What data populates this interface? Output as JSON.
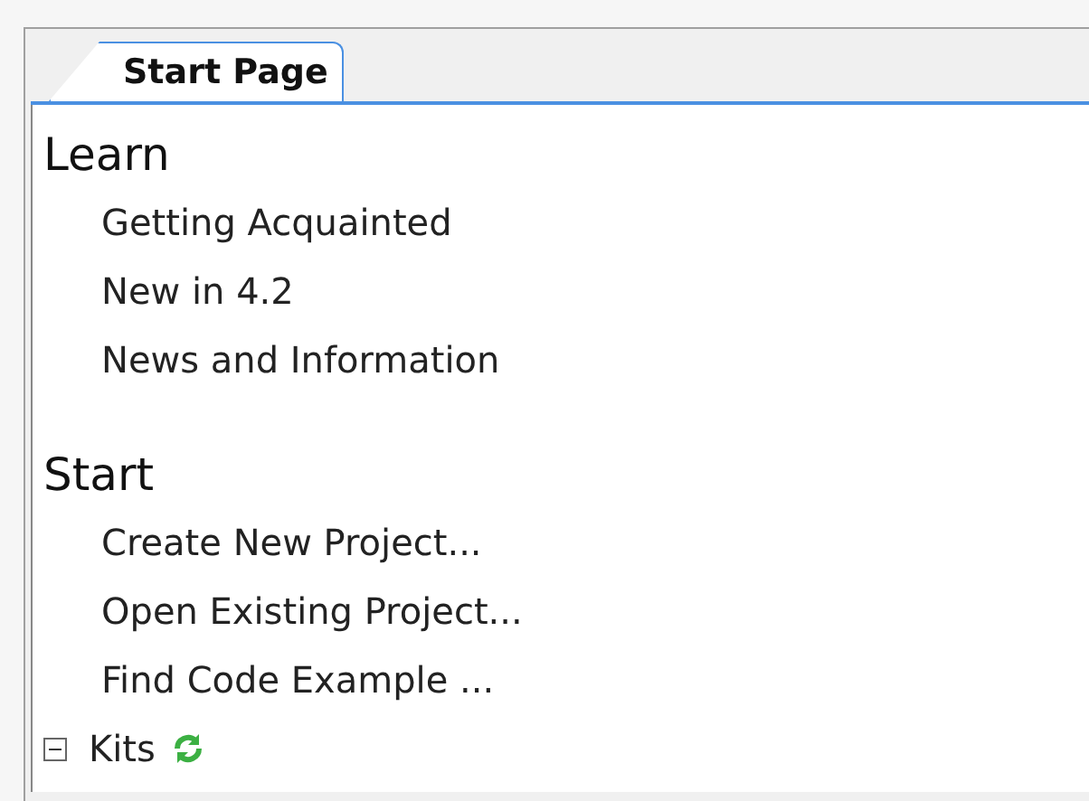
{
  "tabs": [
    {
      "label": "Start Page",
      "selected": true
    }
  ],
  "sections": [
    {
      "heading": "Learn",
      "items": [
        "Getting Acquainted",
        "New in 4.2",
        "News and Information"
      ]
    },
    {
      "heading": "Start",
      "items": [
        "Create New Project...",
        "Open Existing Project...",
        "Find Code Example ..."
      ]
    }
  ],
  "kits": {
    "label": "Kits",
    "expanded": true
  }
}
